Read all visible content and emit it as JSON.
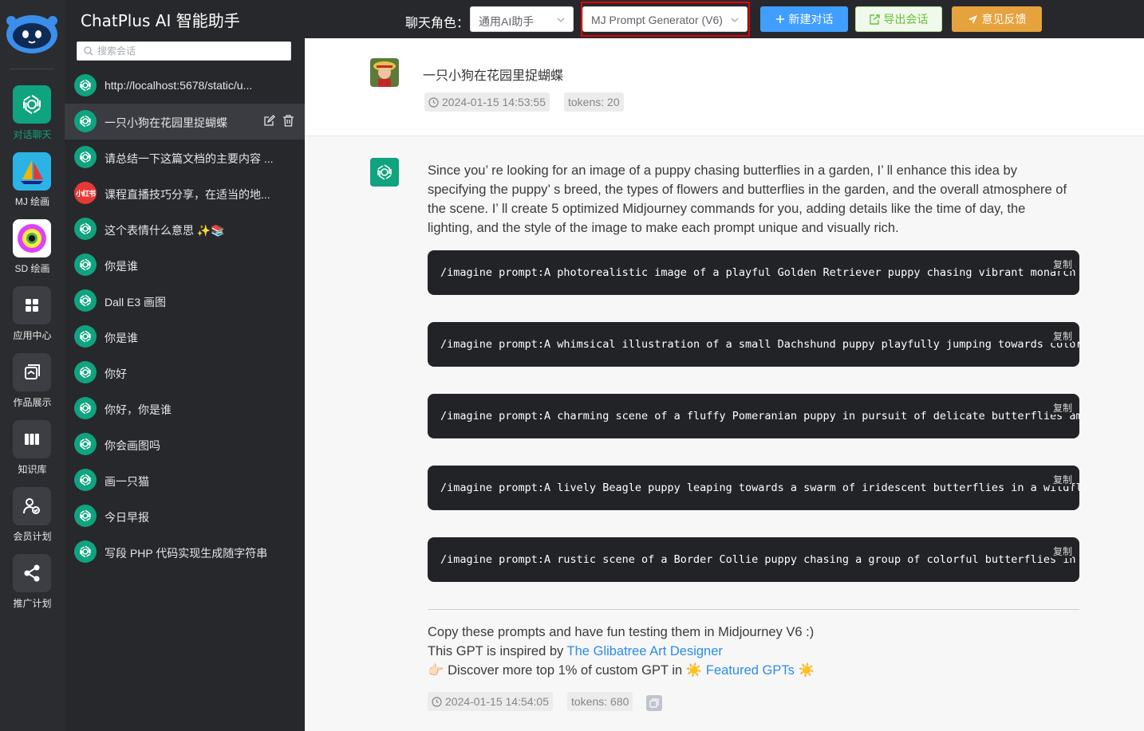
{
  "app": {
    "title": "ChatPlus AI 智能助手"
  },
  "nav": [
    {
      "label": "对话聊天",
      "icon": "openai-icon",
      "active": true
    },
    {
      "label": "MJ 绘画",
      "icon": "sailboat-icon"
    },
    {
      "label": "SD 绘画",
      "icon": "eye-art-icon"
    },
    {
      "label": "应用中心",
      "icon": "grid-icon"
    },
    {
      "label": "作品展示",
      "icon": "gallery-icon"
    },
    {
      "label": "知识库",
      "icon": "book-icon"
    },
    {
      "label": "会员计划",
      "icon": "member-icon"
    },
    {
      "label": "推广计划",
      "icon": "share-icon"
    }
  ],
  "search": {
    "placeholder": "搜索会话"
  },
  "chats": [
    {
      "title": "http://localhost:5678/static/u..."
    },
    {
      "title": "一只小狗在花园里捉蝴蝶",
      "active": true
    },
    {
      "title": "请总结一下这篇文档的主要内容 ..."
    },
    {
      "title": "课程直播技巧分享，在适当的地...",
      "avatar_text": "小红书"
    },
    {
      "title": "这个表情什么意思 ✨📚"
    },
    {
      "title": "你是谁"
    },
    {
      "title": "Dall E3 画图"
    },
    {
      "title": "你是谁"
    },
    {
      "title": "你好"
    },
    {
      "title": "你好，你是谁"
    },
    {
      "title": "你会画图吗"
    },
    {
      "title": "画一只猫"
    },
    {
      "title": "今日早报"
    },
    {
      "title": "写段 PHP 代码实现生成随字符串"
    }
  ],
  "header": {
    "role_label": "聊天角色：",
    "role_select": "通用AI助手",
    "model_select": "MJ Prompt Generator (V6)",
    "new_chat": "新建对话",
    "export": "导出会话",
    "feedback": "意见反馈"
  },
  "user_message": {
    "text": "一只小狗在花园里捉蝴蝶",
    "time": "2024-01-15 14:53:55",
    "tokens": "tokens: 20"
  },
  "bot_message": {
    "intro": "Since you’ re looking for an image of a puppy chasing butterflies in a garden, I’ ll enhance this idea by specifying the puppy’ s breed, the types of flowers and butterflies in the garden, and the overall atmosphere of the scene. I’ ll create 5 optimized Midjourney commands for you, adding details like the time of day, the lighting, and the style of the image to make each prompt unique and visually rich.",
    "copy_label": "复制",
    "prompts": [
      "/imagine prompt:A photorealistic image of a playful Golden Retriever puppy chasing vibrant monarch b",
      "/imagine prompt:A whimsical illustration of a small Dachshund puppy playfully jumping towards colorf",
      "/imagine prompt:A charming scene of a fluffy Pomeranian puppy in pursuit of delicate butterflies amo",
      "/imagine prompt:A lively Beagle puppy leaping towards a swarm of iridescent butterflies in a wildflo",
      "/imagine prompt:A rustic scene of a Border Collie puppy chasing a group of colorful butterflies in a"
    ],
    "outro1": "Copy these prompts and have fun testing them in Midjourney V6 :)",
    "outro2_prefix": "This GPT is inspired by ",
    "outro2_link": "The Glibatree Art Designer",
    "outro3_prefix": "👉🏻 Discover more top 1% of custom GPT in ",
    "outro3_link": "Featured GPTs",
    "time": "2024-01-15 14:54:05",
    "tokens": "tokens: 680"
  },
  "colors": {
    "accent": "#10a37f",
    "primary": "#409eff",
    "warning": "#e6a23c",
    "success": "#67c23a",
    "highlight": "#e60000"
  }
}
